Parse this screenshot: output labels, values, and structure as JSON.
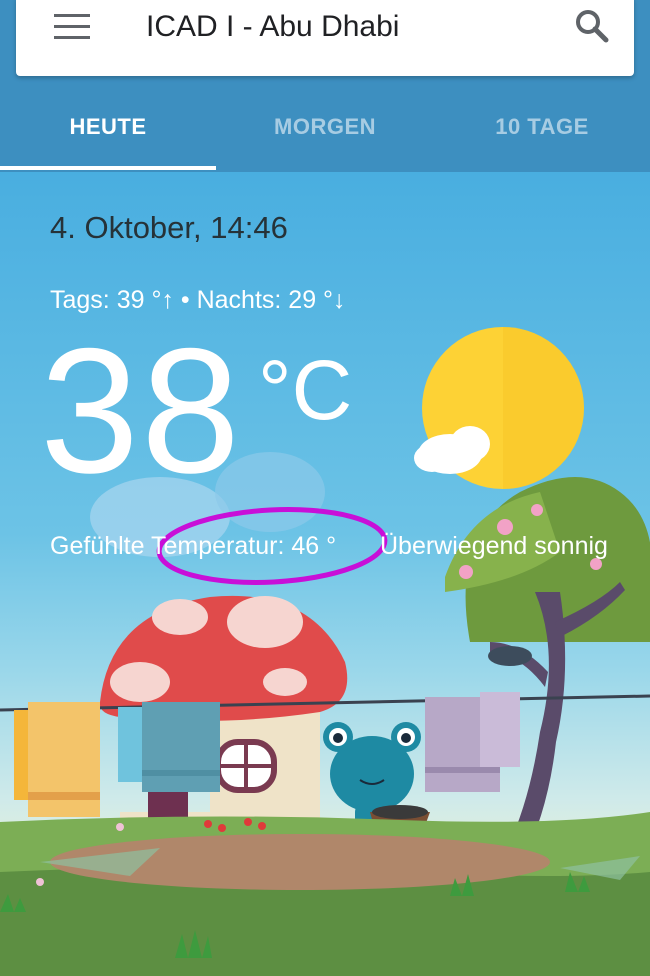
{
  "header": {
    "location": "ICAD I - Abu Dhabi",
    "menu_icon": "hamburger-menu-icon",
    "search_icon": "search-icon"
  },
  "tabs": [
    {
      "label": "HEUTE",
      "active": true
    },
    {
      "label": "MORGEN",
      "active": false
    },
    {
      "label": "10 TAGE",
      "active": false
    }
  ],
  "weather": {
    "datetime": "4. Oktober, 14:46",
    "high_low": "Tags: 39 °↑ • Nachts: 29 °↓",
    "temperature": "38",
    "unit": "°C",
    "feels_like": "Gefühlte Temperatur: 46 °",
    "condition": "Überwiegend sonnig"
  },
  "colors": {
    "app_bar": "#3d8fc0",
    "sky": "#49aee0",
    "annotation_circle": "#c80fd8",
    "sun": "#fdd235"
  }
}
